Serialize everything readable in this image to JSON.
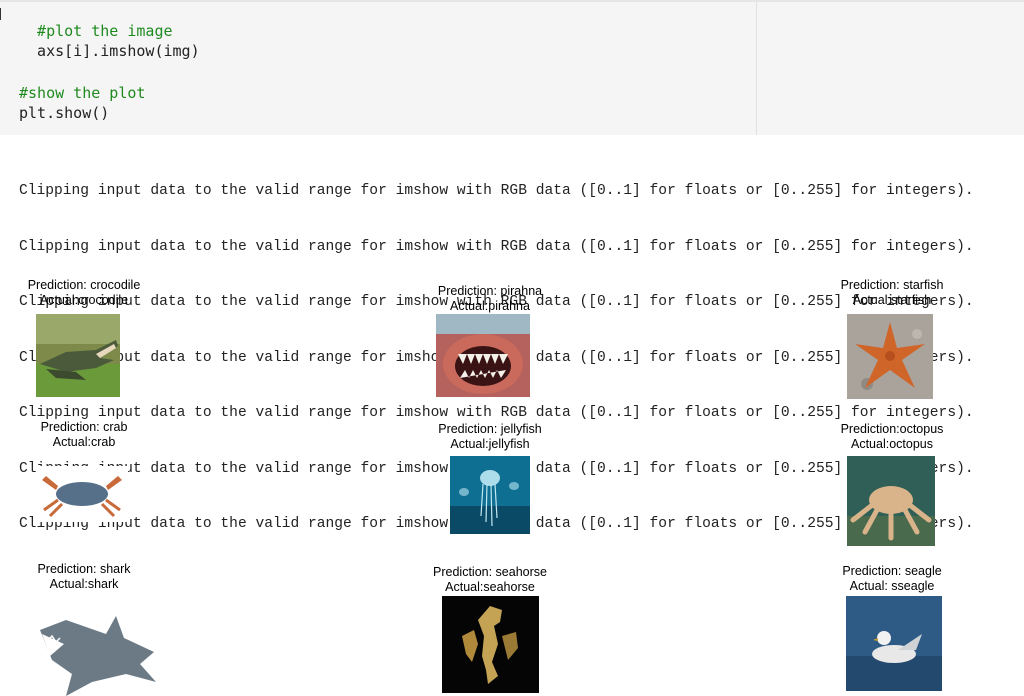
{
  "code_cell": {
    "lines": [
      {
        "text": "  #plot the image",
        "kind": "comment"
      },
      {
        "text": "  axs[i].imshow(img)",
        "kind": "code"
      },
      {
        "text": "",
        "kind": "code"
      },
      {
        "text": "#show the plot",
        "kind": "comment"
      },
      {
        "text": "plt.show()",
        "kind": "code"
      }
    ]
  },
  "output": {
    "warning_text": "Clipping input data to the valid range for imshow with RGB data ([0..1] for floats or [0..255] for integers).",
    "lines": [
      "Clipping input data to the valid range for imshow with RGB data ([0..1] for floats or [0..255] for integers).",
      "Clipping input data to the valid range for imshow with RGB data ([0..1] for floats or [0..255] for integers).",
      "Clipping input data to the valid range for imshow with RGB data ([0..1] for floats or [0..255] for integers).",
      "Clipping input data to the valid range for imshow with RGB data ([0..1] for floats or [0..255] for integers).",
      "Clipping input data to the valid range for imshow with RGB data ([0..1] for floats or [0..255] for integers).",
      "Clipping input data to the valid range for imshow with RGB data ([0..1] for floats or [0..255] for integers).",
      "Clipping input data to the valid range for imshow with RGB data ([0..1] for floats or [0..255] for integers)."
    ]
  },
  "figures": [
    {
      "prediction": "Prediction: crocodile",
      "actual": "Actual:crocodile"
    },
    {
      "prediction": "Prediction: pirahna",
      "actual": "Actual:pirahna"
    },
    {
      "prediction": "Prediction: starfish",
      "actual": "Actual:starfish"
    },
    {
      "prediction": "Prediction: crab",
      "actual": "Actual:crab"
    },
    {
      "prediction": "Prediction: jellyfish",
      "actual": "Actual:jellyfish"
    },
    {
      "prediction": "Prediction:octopus",
      "actual": "Actual:octopus"
    },
    {
      "prediction": "Prediction: shark",
      "actual": "Actual:shark"
    },
    {
      "prediction": "Prediction: seahorse",
      "actual": "Actual:seahorse"
    },
    {
      "prediction": "Prediction: seagle",
      "actual": "Actual: sseagle"
    }
  ],
  "colors": {
    "comment": "#1f8a1f",
    "code": "#222222",
    "cell_background": "#f5f5f5"
  }
}
